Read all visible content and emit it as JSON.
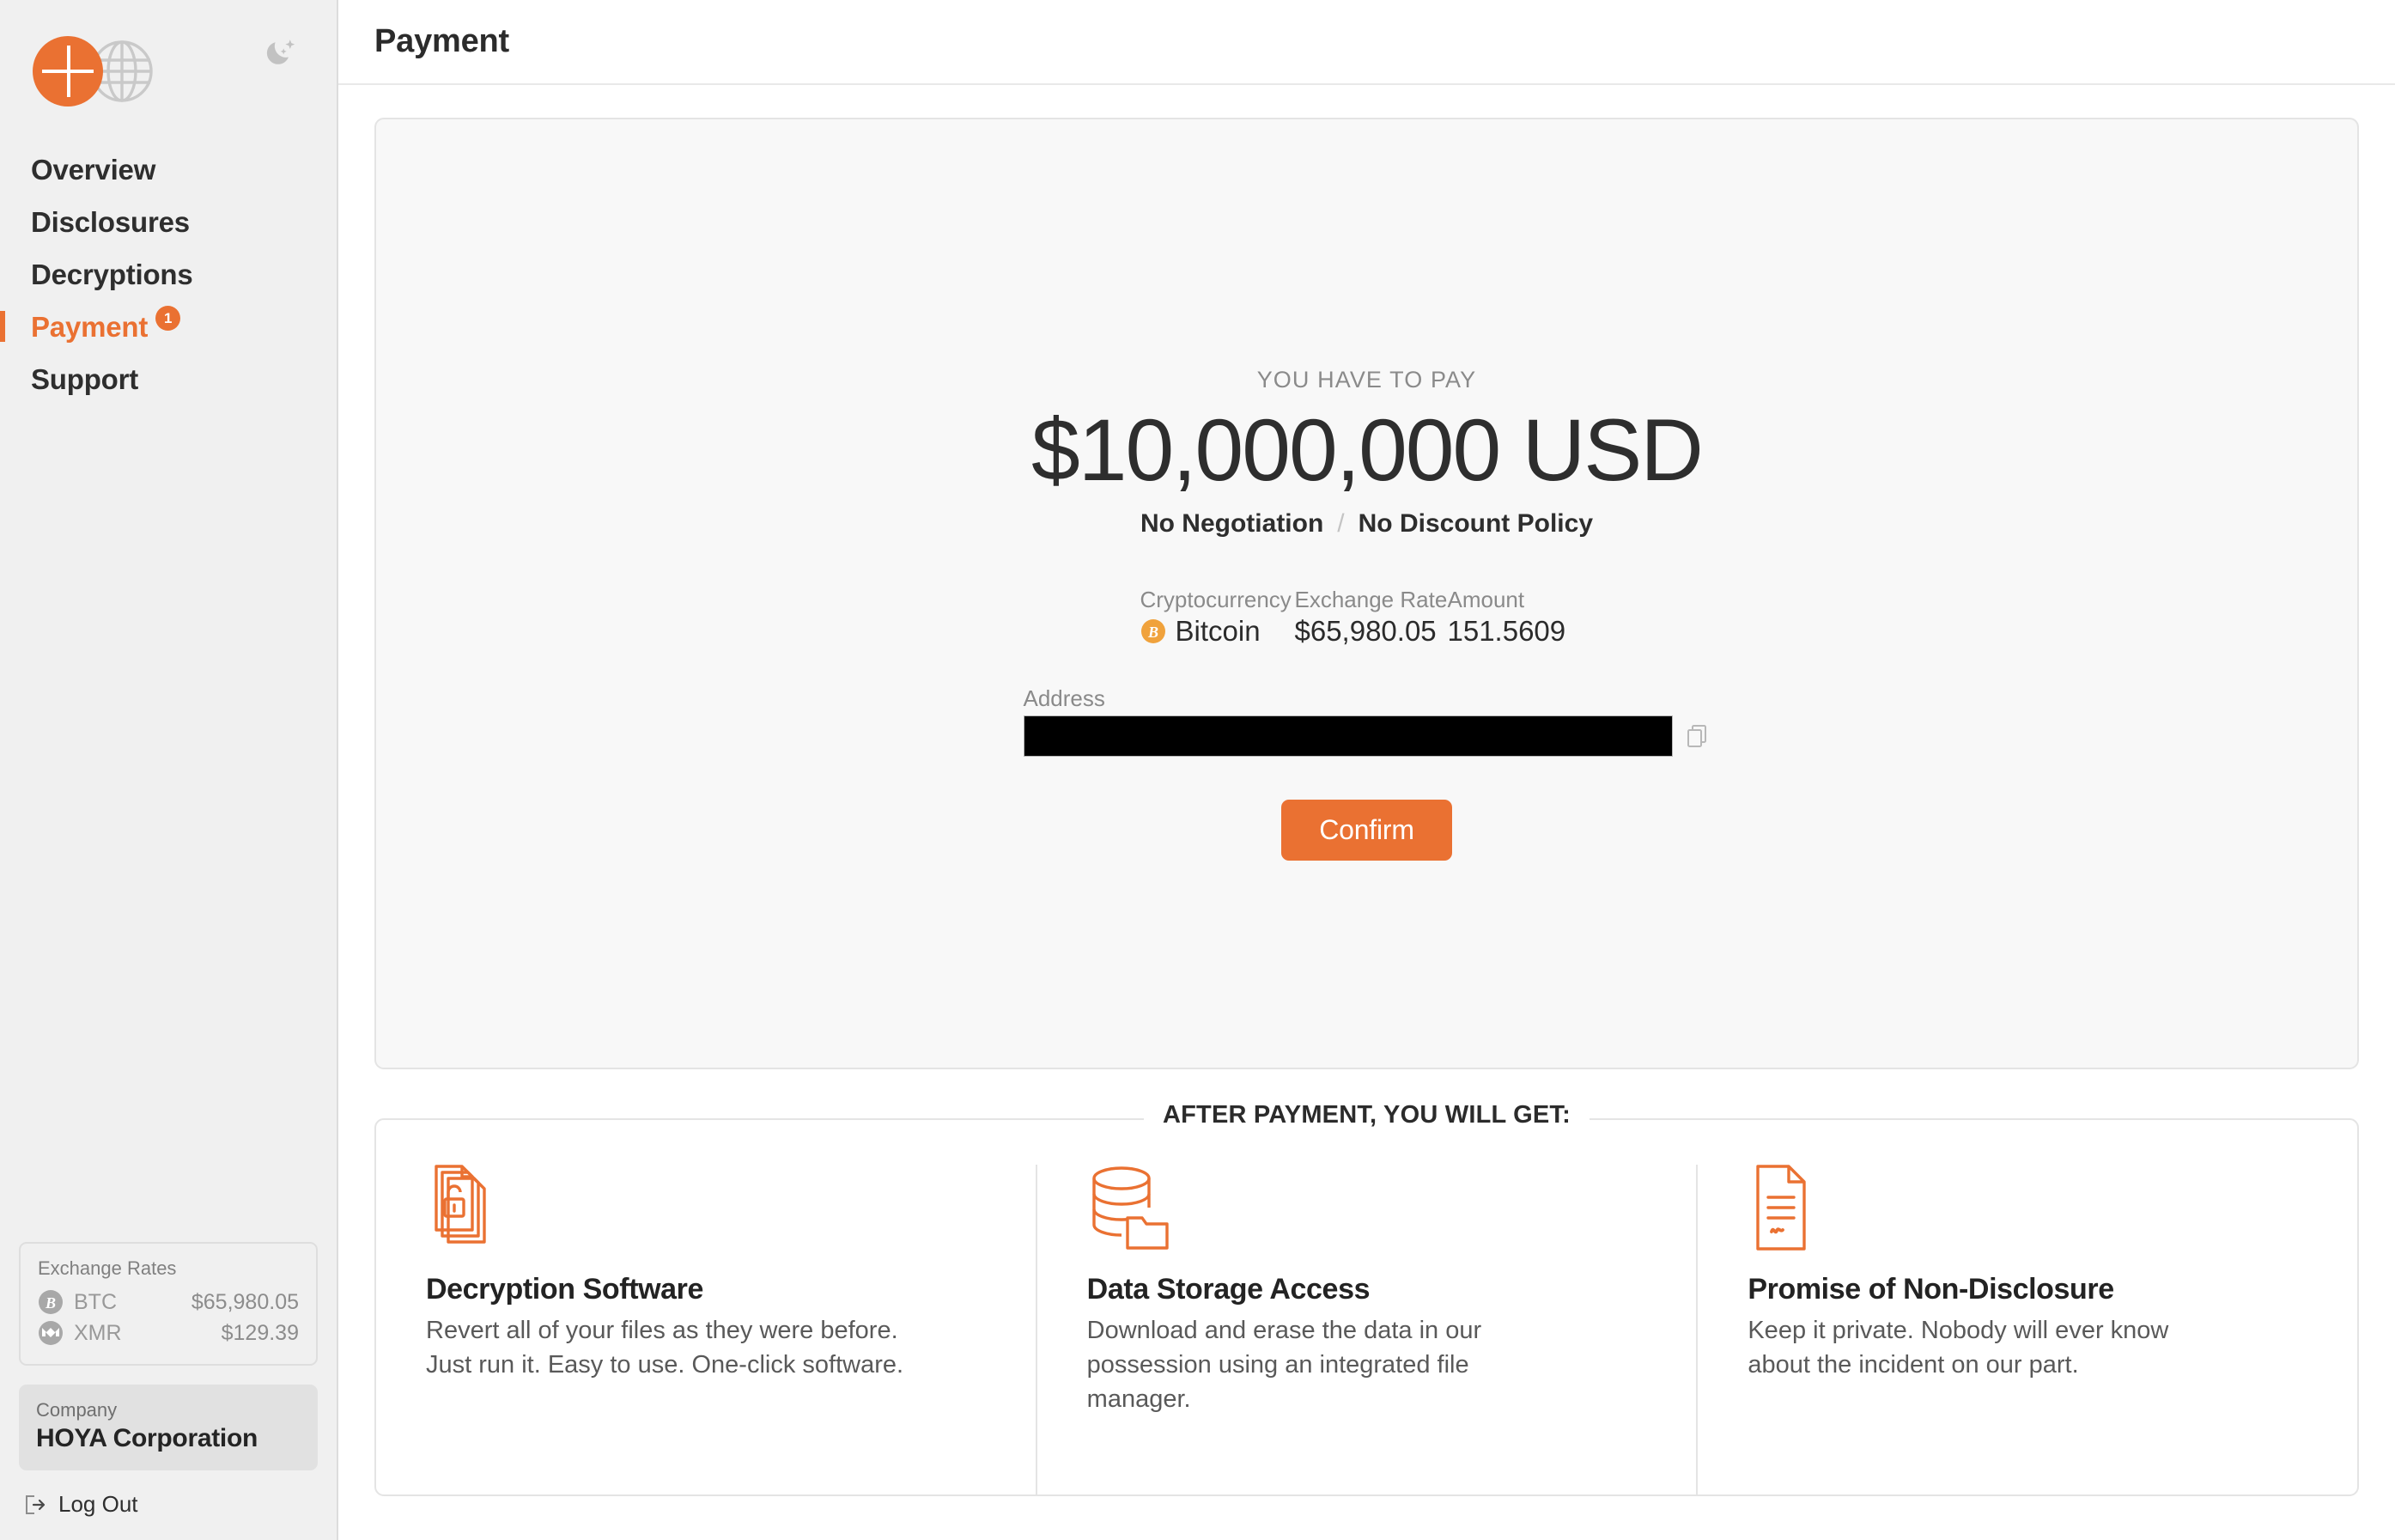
{
  "sidebar": {
    "logo_name": "crosshair-globe-logo",
    "theme_toggle_icon": "moon-stars-icon",
    "nav": [
      {
        "label": "Overview",
        "active": false,
        "badge": null
      },
      {
        "label": "Disclosures",
        "active": false,
        "badge": null
      },
      {
        "label": "Decryptions",
        "active": false,
        "badge": null
      },
      {
        "label": "Payment",
        "active": true,
        "badge": "1"
      },
      {
        "label": "Support",
        "active": false,
        "badge": null
      }
    ],
    "exchange_rates": {
      "title": "Exchange Rates",
      "rows": [
        {
          "icon": "bitcoin-icon",
          "symbol": "BTC",
          "value": "$65,980.05"
        },
        {
          "icon": "monero-icon",
          "symbol": "XMR",
          "value": "$129.39"
        }
      ]
    },
    "company": {
      "label": "Company",
      "name": "HOYA Corporation"
    },
    "logout": {
      "label": "Log Out",
      "icon": "logout-icon"
    }
  },
  "header": {
    "title": "Payment"
  },
  "payment": {
    "eyebrow": "YOU HAVE TO PAY",
    "amount": "$10,000,000 USD",
    "term_left": "No Negotiation",
    "term_separator": "/",
    "term_right": "No Discount Policy",
    "fields": {
      "cryptocurrency_label": "Cryptocurrency",
      "cryptocurrency_value": "Bitcoin",
      "cryptocurrency_icon": "bitcoin-icon",
      "exchange_rate_label": "Exchange Rate",
      "exchange_rate_value": "$65,980.05",
      "amount_label": "Amount",
      "amount_value": "151.5609"
    },
    "address": {
      "label": "Address",
      "value": "",
      "redacted": true,
      "copy_icon": "copy-icon"
    },
    "confirm_label": "Confirm"
  },
  "benefits": {
    "heading": "AFTER PAYMENT, YOU WILL GET:",
    "items": [
      {
        "icon": "documents-unlocked-icon",
        "title": "Decryption Software",
        "desc": "Revert all of your files as they were before. Just run it. Easy to use. One-click software."
      },
      {
        "icon": "database-folder-icon",
        "title": "Data Storage Access",
        "desc": "Download and erase the data in our possession using an integrated file manager."
      },
      {
        "icon": "signed-document-icon",
        "title": "Promise of Non-Disclosure",
        "desc": "Keep it private. Nobody will ever know about the incident on our part."
      }
    ]
  },
  "colors": {
    "accent": "#ea7132",
    "sidebar_bg": "#f0f0f0",
    "panel_bg": "#f8f8f8",
    "text": "#2e2e2e",
    "muted": "#8a8a8a"
  }
}
